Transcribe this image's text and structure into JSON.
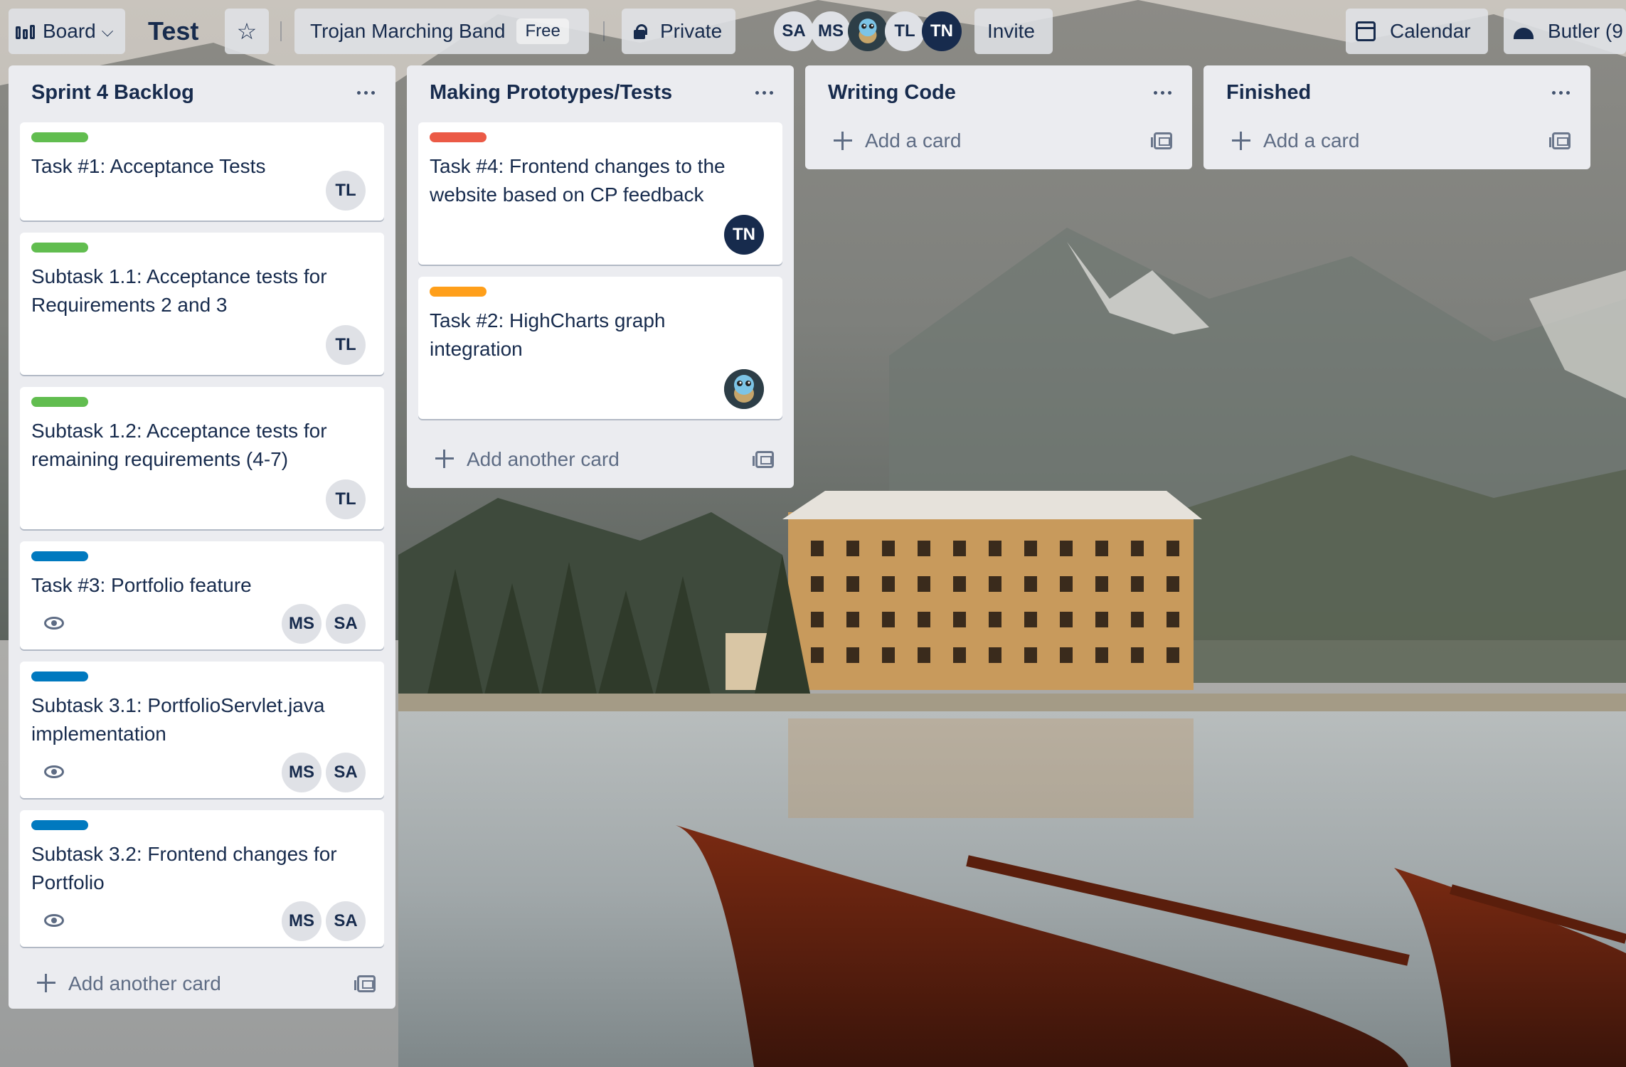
{
  "header": {
    "view_switcher": "Board",
    "board_title": "Test",
    "team_name": "Trojan Marching Band",
    "team_plan": "Free",
    "visibility": "Private",
    "members": [
      "SA",
      "MS",
      "",
      "TL",
      "TN"
    ],
    "invite_label": "Invite",
    "calendar_label": "Calendar",
    "butler_label": "Butler (9"
  },
  "colors": {
    "label_green": "#61bd4f",
    "label_red": "#eb5a46",
    "label_orange": "#ff9f1a",
    "label_blue": "#0079bf",
    "list_bg": "#ebecf0",
    "avatar_dark": "#172b4d"
  },
  "lists": [
    {
      "title": "Sprint 4 Backlog",
      "add_label": "Add another card",
      "cards": [
        {
          "title": "Task #1: Acceptance Tests",
          "label": "green",
          "members": [
            "TL"
          ],
          "watch": false
        },
        {
          "title": "Subtask 1.1: Acceptance tests for Requirements 2 and 3",
          "label": "green",
          "members": [
            "TL"
          ],
          "watch": false
        },
        {
          "title": "Subtask 1.2: Acceptance tests for remaining requirements (4-7)",
          "label": "green",
          "members": [
            "TL"
          ],
          "watch": false
        },
        {
          "title": "Task #3: Portfolio feature",
          "label": "blue",
          "members": [
            "MS",
            "SA"
          ],
          "watch": true
        },
        {
          "title": "Subtask 3.1: PortfolioServlet.java implementation",
          "label": "blue",
          "members": [
            "MS",
            "SA"
          ],
          "watch": true
        },
        {
          "title": "Subtask 3.2: Frontend changes for Portfolio",
          "label": "blue",
          "members": [
            "MS",
            "SA"
          ],
          "watch": true
        }
      ]
    },
    {
      "title": "Making Prototypes/Tests",
      "add_label": "Add another card",
      "cards": [
        {
          "title": "Task #4: Frontend changes to the website based on CP feedback",
          "label": "red",
          "members": [
            "TN"
          ],
          "watch": false
        },
        {
          "title": "Task #2: HighCharts graph integration",
          "label": "orange",
          "members": [
            "squirtle"
          ],
          "watch": false
        }
      ]
    },
    {
      "title": "Writing Code",
      "add_label": "Add a card",
      "cards": []
    },
    {
      "title": "Finished",
      "add_label": "Add a card",
      "cards": []
    }
  ]
}
